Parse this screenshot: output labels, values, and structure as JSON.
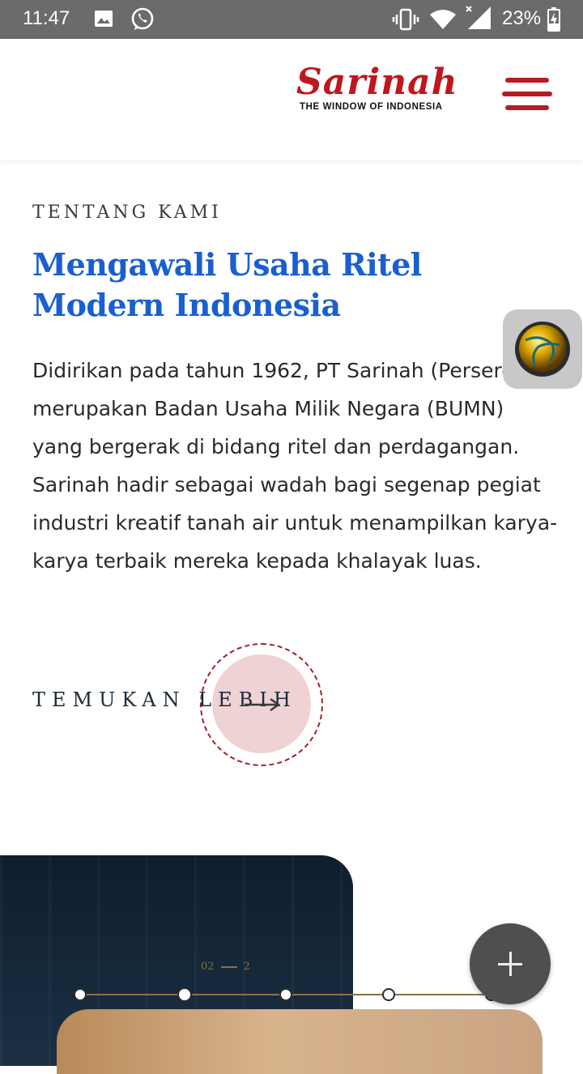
{
  "status_bar": {
    "time": "11:47",
    "battery": "23%",
    "icons": [
      "image-icon",
      "whatsapp-icon",
      "vibrate-icon",
      "wifi-icon",
      "signal-icon",
      "battery-charging-icon"
    ]
  },
  "header": {
    "logo_text": "Sarinah",
    "logo_tagline": "THE WINDOW OF INDONESIA",
    "brand_color": "#c0161d",
    "menu_icon": "hamburger-menu-icon"
  },
  "about": {
    "eyebrow": "TENTANG KAMI",
    "title": "Mengawali Usaha Ritel Modern Indonesia",
    "title_color": "#1a5fd0",
    "description": "Didirikan pada tahun 1962, PT Sarinah (Persero) merupakan Badan Usaha Milik Negara (BUMN) yang bergerak di bidang ritel dan perdagangan. Sarinah hadir sebagai wadah bagi segenap pegiat industri kreatif tanah air untuk menampilkan karya-karya terbaik mereka kepada khalayak luas.",
    "cta_label": "TEMUKAN LEBIH",
    "cta_icon": "arrow-right-icon"
  },
  "timeline": {
    "pager_current": "02",
    "pager_total": "2",
    "dots": 5,
    "accent_color": "#8a7048"
  },
  "floating": {
    "ball_icon": "ball-overlay-icon",
    "fab_icon": "plus-icon"
  }
}
